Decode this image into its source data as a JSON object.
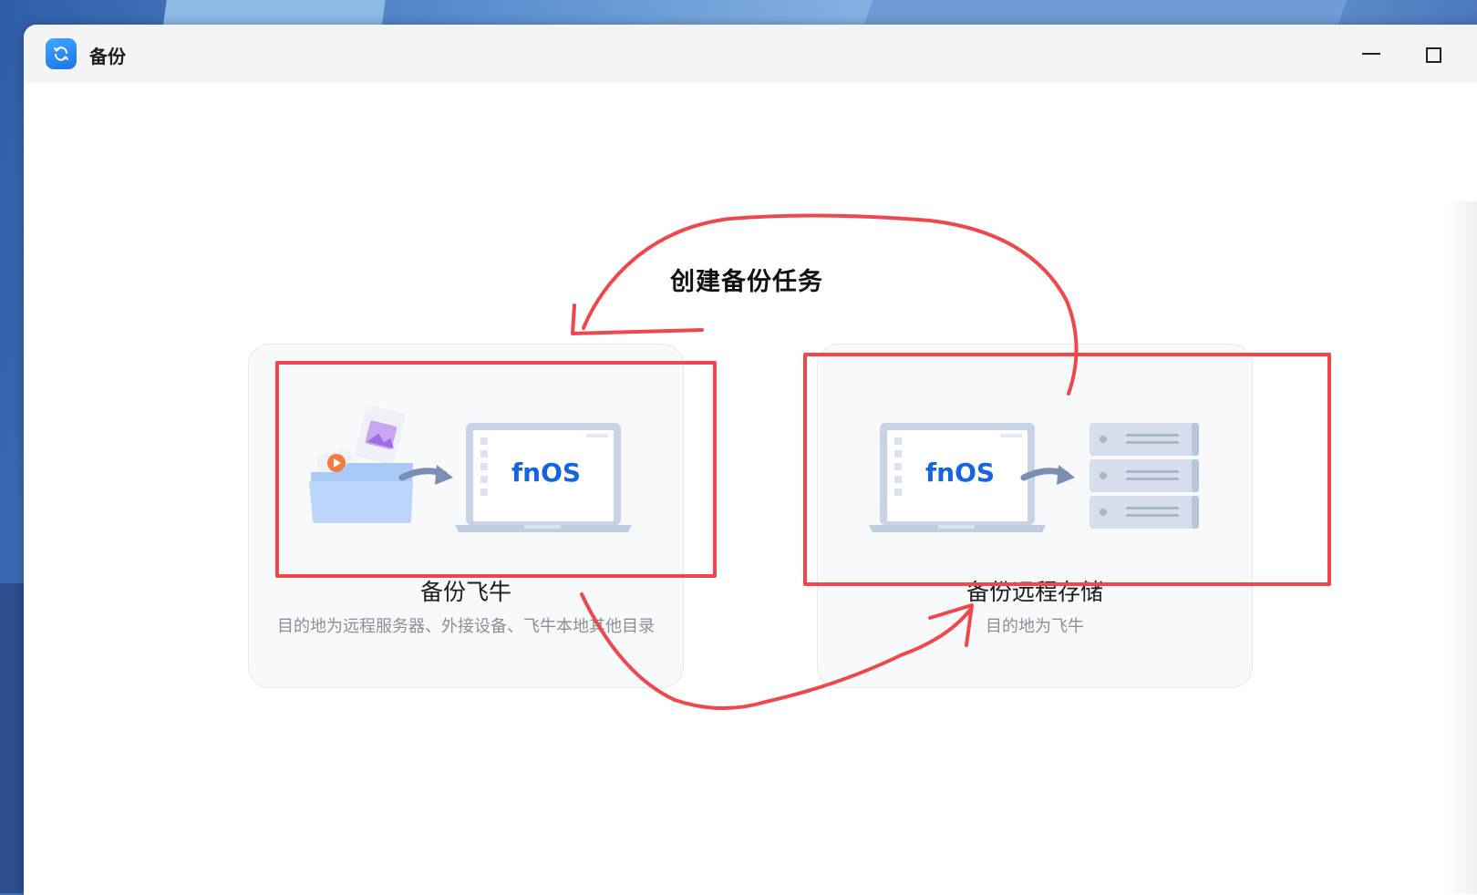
{
  "window": {
    "title": "备份",
    "app_icon": "backup-sync-icon",
    "controls": [
      "minimize-icon",
      "maximize-icon"
    ]
  },
  "annotation": {
    "label": "创建备份任务",
    "color": "#f0474d"
  },
  "cards": [
    {
      "id": "backup-fnos",
      "title": "备份飞牛",
      "description": "目的地为远程服务器、外接设备、飞牛本地其他目录",
      "illustration": {
        "source_icon": "folder-files-icon",
        "arrow_icon": "arrow-right-icon",
        "target_icon": "laptop-icon",
        "laptop_text": "fnOS"
      }
    },
    {
      "id": "backup-remote",
      "title": "备份远程存储",
      "description": "目的地为飞牛",
      "illustration": {
        "source_icon": "laptop-icon",
        "arrow_icon": "arrow-right-icon",
        "target_icon": "server-rack-icon",
        "laptop_text": "fnOS"
      }
    }
  ],
  "colors": {
    "accent": "#1a73e8",
    "fnos_text": "#1565e0",
    "card_bg": "#f8f9fa",
    "annotation": "#f0474d"
  }
}
